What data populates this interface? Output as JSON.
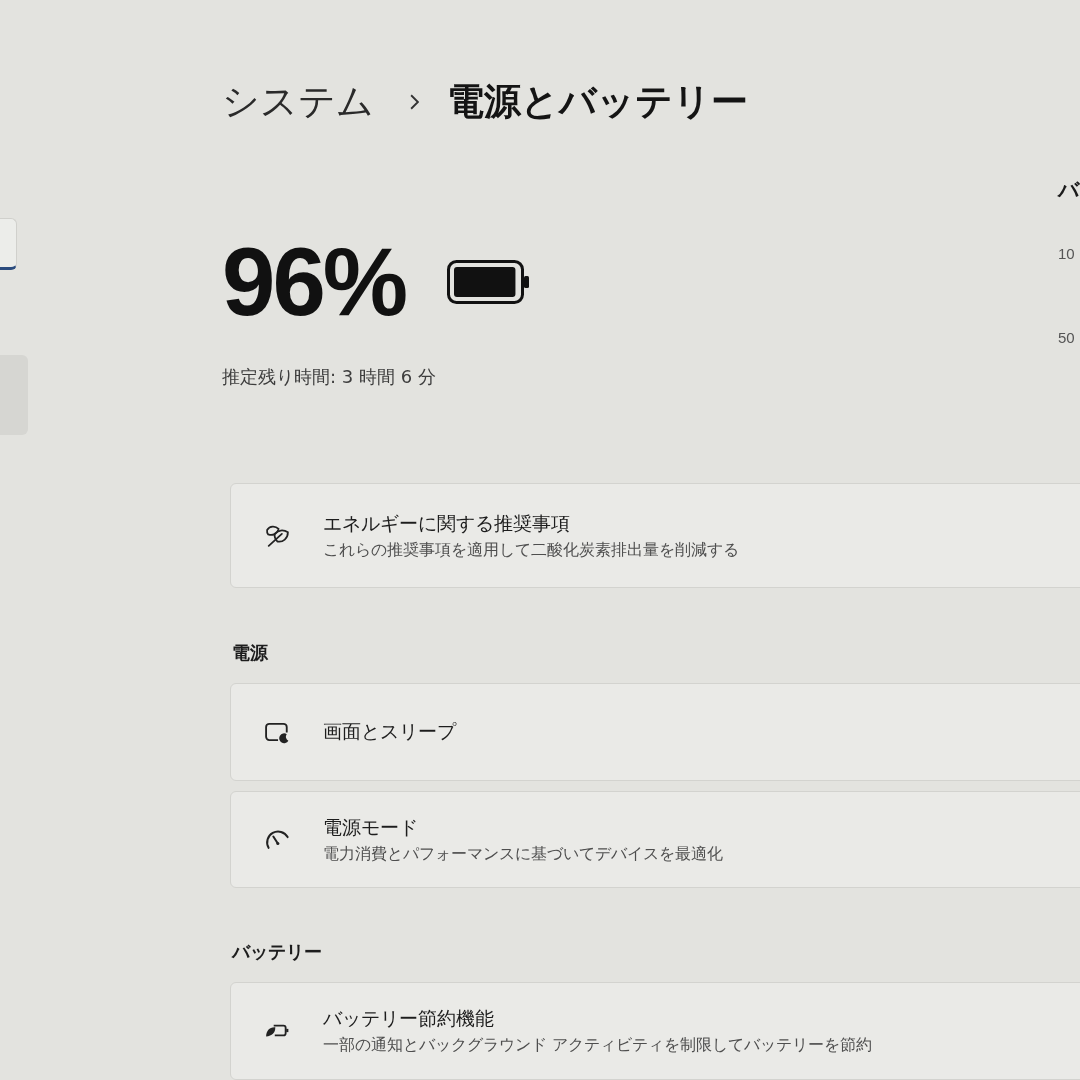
{
  "sidebar": {
    "items": [
      {
        "selected": true
      }
    ]
  },
  "breadcrumb": {
    "parent": "システム",
    "current": "電源とバッテリー"
  },
  "battery": {
    "percent": "96%",
    "level": 0.96,
    "remaining": "推定残り時間: 3 時間 6 分"
  },
  "usage_panel": {
    "title": "バ",
    "axis_labels": [
      "10",
      "50"
    ]
  },
  "cards": [
    {
      "kind": "energy",
      "title": "エネルギーに関する推奨事項",
      "description": "これらの推奨事項を適用して二酸化炭素排出量を削減する"
    }
  ],
  "sections": [
    {
      "heading": "電源",
      "cards": [
        {
          "kind": "sleep",
          "title": "画面とスリープ"
        },
        {
          "kind": "mode",
          "title": "電源モード",
          "description": "電力消費とパフォーマンスに基づいてデバイスを最適化"
        }
      ]
    },
    {
      "heading": "バッテリー",
      "cards": [
        {
          "kind": "saver",
          "title": "バッテリー節約機能",
          "description": "一部の通知とバックグラウンド アクティビティを制限してバッテリーを節約"
        }
      ]
    }
  ]
}
